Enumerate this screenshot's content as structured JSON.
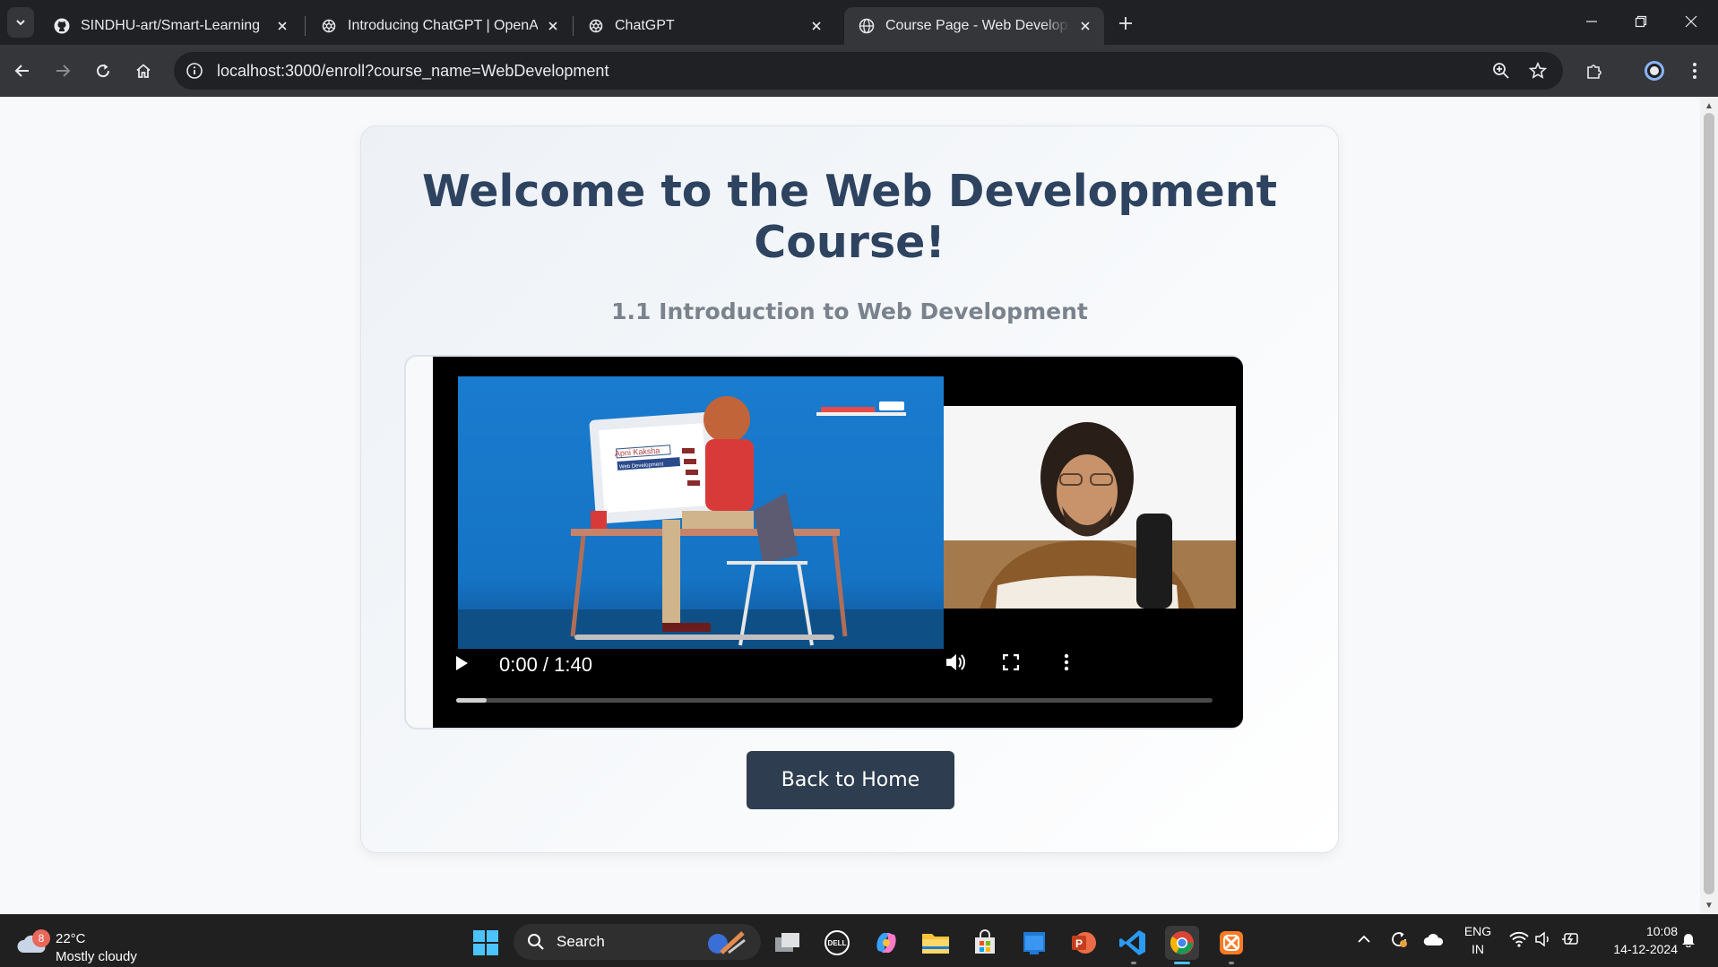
{
  "browser": {
    "tabs": [
      {
        "title": "SINDHU-art/Smart-Learning",
        "favicon": "github-icon",
        "active": false
      },
      {
        "title": "Introducing ChatGPT | OpenAI",
        "favicon": "openai-icon",
        "active": false
      },
      {
        "title": "ChatGPT",
        "favicon": "openai-icon",
        "active": false
      },
      {
        "title": "Course Page - Web Development",
        "favicon": "globe-icon",
        "active": true
      }
    ],
    "url": "localhost:3000/enroll?course_name=WebDevelopment"
  },
  "page": {
    "title": "Welcome to the Web Development Course!",
    "subtitle": "1.1 Introduction to Web Development",
    "video": {
      "time_current": "0:00",
      "time_total": "1:40",
      "time_display": "0:00 / 1:40",
      "progress_fraction": 0.04,
      "slide_texts": {
        "brand": "Apni Kaksha",
        "topic": "Web Development"
      }
    },
    "back_button_label": "Back to Home"
  },
  "taskbar": {
    "weather_badge": "8",
    "weather_temp": "22°C",
    "weather_condition": "Mostly cloudy",
    "search_label": "Search",
    "lang_primary": "ENG",
    "lang_secondary": "IN",
    "time": "10:08",
    "date": "14-12-2024"
  },
  "colors": {
    "title": "#2e4360",
    "subtitle": "#7a838d",
    "button_bg": "#2e3d50",
    "browser_dark": "#202124",
    "browser_toolbar": "#35363a"
  }
}
